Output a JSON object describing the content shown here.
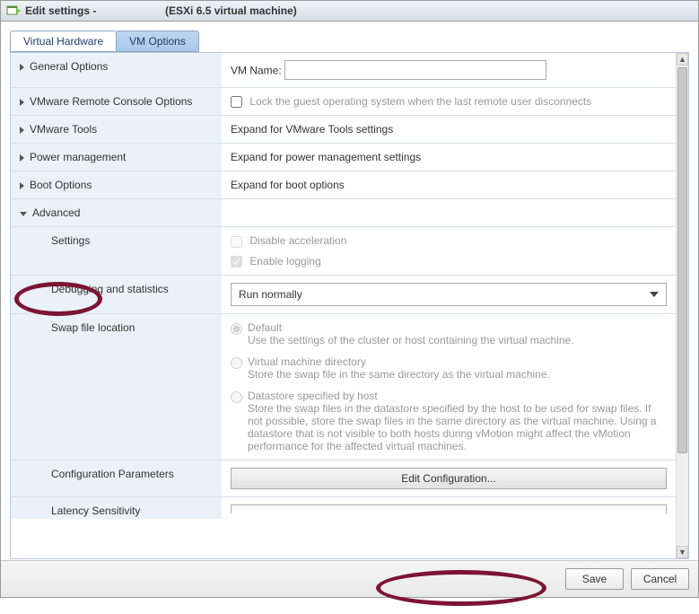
{
  "title": {
    "prefix": "Edit settings -",
    "suffix": "(ESXi 6.5 virtual machine)"
  },
  "tabs": {
    "hardware": "Virtual Hardware",
    "options": "VM Options"
  },
  "rows": {
    "general": {
      "label": "General Options",
      "vmNameLabel": "VM Name:",
      "vmNameValue": ""
    },
    "remote": {
      "label": "VMware Remote Console Options",
      "checkbox": "Lock the guest operating system when the last remote user disconnects"
    },
    "tools": {
      "label": "VMware Tools",
      "value": "Expand for VMware Tools settings"
    },
    "power": {
      "label": "Power management",
      "value": "Expand for power management settings"
    },
    "boot": {
      "label": "Boot Options",
      "value": "Expand for boot options"
    },
    "advanced": {
      "label": "Advanced"
    },
    "settings": {
      "label": "Settings",
      "disable": "Disable acceleration",
      "enable": "Enable logging"
    },
    "debug": {
      "label": "Debugging and statistics",
      "value": "Run normally"
    },
    "swap": {
      "label": "Swap file location",
      "opt1": {
        "title": "Default",
        "desc": "Use the settings of the cluster or host containing the virtual machine."
      },
      "opt2": {
        "title": "Virtual machine directory",
        "desc": "Store the swap file in the same directory as the virtual machine."
      },
      "opt3": {
        "title": "Datastore specified by host",
        "desc": "Store the swap files in the datastore specified by the host to be used for swap files. If not possible, store the swap files in the same directory as the virtual machine. Using a datastore that is not visible to both hosts during vMotion might affect the vMotion performance for the affected virtual machines."
      }
    },
    "config": {
      "label": "Configuration Parameters",
      "button": "Edit Configuration..."
    },
    "latency": {
      "label": "Latency Sensitivity"
    }
  },
  "footer": {
    "save": "Save",
    "cancel": "Cancel"
  }
}
